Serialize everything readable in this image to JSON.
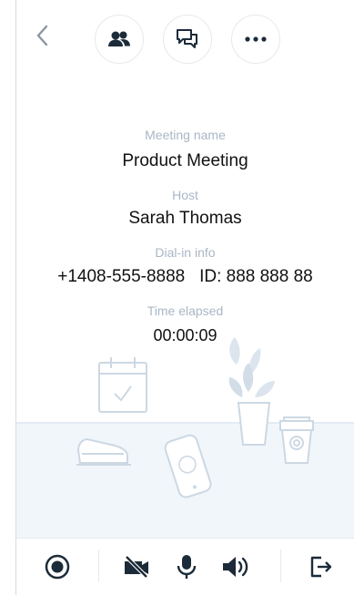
{
  "header": {
    "back_icon": "chevron-left-icon",
    "participants_icon": "participants-icon",
    "chat_icon": "chat-icon",
    "more_icon": "more-icon"
  },
  "meeting": {
    "name_label": "Meeting name",
    "name": "Product Meeting",
    "host_label": "Host",
    "host": "Sarah Thomas",
    "dialin_label": "Dial-in info",
    "dialin": "+1408-555-8888   ID: 888 888 88",
    "elapsed_label": "Time elapsed",
    "elapsed": "00:00:09"
  },
  "toolbar": {
    "record_icon": "record-icon",
    "video_off_icon": "video-off-icon",
    "mic_icon": "microphone-icon",
    "speaker_icon": "speaker-icon",
    "leave_icon": "leave-icon"
  },
  "colors": {
    "accent": "#1c2b39",
    "label": "#a9b7c6",
    "illustration": "#c9d6e2",
    "floor": "#f1f6fb"
  }
}
